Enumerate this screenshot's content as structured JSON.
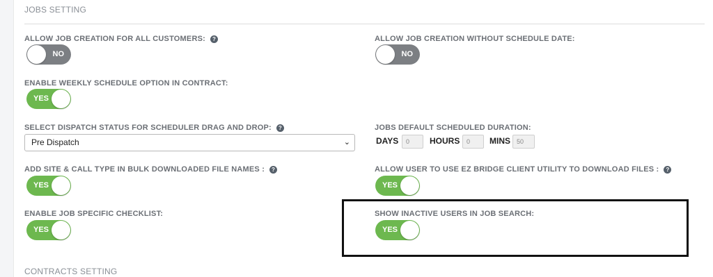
{
  "jobs_section_title": "JOBS SETTING",
  "contracts_section_title": "CONTRACTS SETTING",
  "help_glyph": "?",
  "settings": {
    "allow_job_creation_all_customers": {
      "label": "ALLOW JOB CREATION FOR ALL CUSTOMERS:",
      "toggle": "NO",
      "help": true
    },
    "allow_job_creation_without_schedule": {
      "label": "ALLOW JOB CREATION WITHOUT SCHEDULE DATE:",
      "toggle": "NO",
      "help": false
    },
    "enable_weekly_schedule": {
      "label": "ENABLE WEEKLY SCHEDULE OPTION IN CONTRACT:",
      "toggle": "YES",
      "help": false
    },
    "dispatch_status": {
      "label": "SELECT DISPATCH STATUS FOR SCHEDULER DRAG AND DROP:",
      "selected": "Pre Dispatch",
      "help": true
    },
    "default_duration": {
      "label": "JOBS DEFAULT SCHEDULED DURATION:",
      "days_label": "DAYS",
      "days_value": "0",
      "hours_label": "HOURS",
      "hours_value": "0",
      "mins_label": "MINS",
      "mins_value": "50"
    },
    "add_site_call_type": {
      "label": "ADD SITE & CALL TYPE IN BULK DOWNLOADED FILE NAMES :",
      "toggle": "YES",
      "help": true
    },
    "ez_bridge_utility": {
      "label": "ALLOW USER TO USE EZ BRIDGE CLIENT UTILITY TO DOWNLOAD FILES :",
      "toggle": "YES",
      "help": true
    },
    "job_specific_checklist": {
      "label": "ENABLE JOB SPECIFIC CHECKLIST:",
      "toggle": "YES",
      "help": false
    },
    "show_inactive_users": {
      "label": "SHOW INACTIVE USERS IN JOB SEARCH:",
      "toggle": "YES",
      "help": false
    }
  },
  "colors": {
    "toggle_on": "#6db84f",
    "toggle_off": "#7c7f83",
    "label": "#6b6f75",
    "highlight_border": "#111111"
  }
}
